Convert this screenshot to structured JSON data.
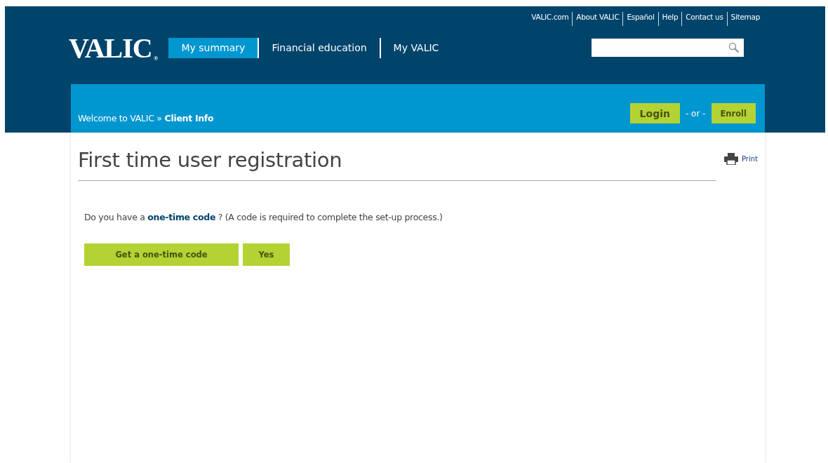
{
  "utility_links": [
    "VALIC.com",
    "About VALIC",
    "Español",
    "Help",
    "Contact us",
    "Sitemap"
  ],
  "logo": {
    "text": "VALIC",
    "mark": "®"
  },
  "nav": [
    {
      "label": "My summary",
      "selected": true
    },
    {
      "label": "Financial education",
      "selected": false
    },
    {
      "label": "My VALIC",
      "selected": false
    }
  ],
  "breadcrumb": {
    "parent": "Welcome to VALIC »",
    "current": "Client Info"
  },
  "auth": {
    "login": "Login",
    "separator": "- or -",
    "enroll": "Enroll"
  },
  "page": {
    "title": "First time user registration",
    "print": "Print",
    "question": "Do you have a **one-time code** ? (A code is required to complete the set-up process.)",
    "buttons": [
      "Get a one-time code",
      "Yes"
    ]
  }
}
